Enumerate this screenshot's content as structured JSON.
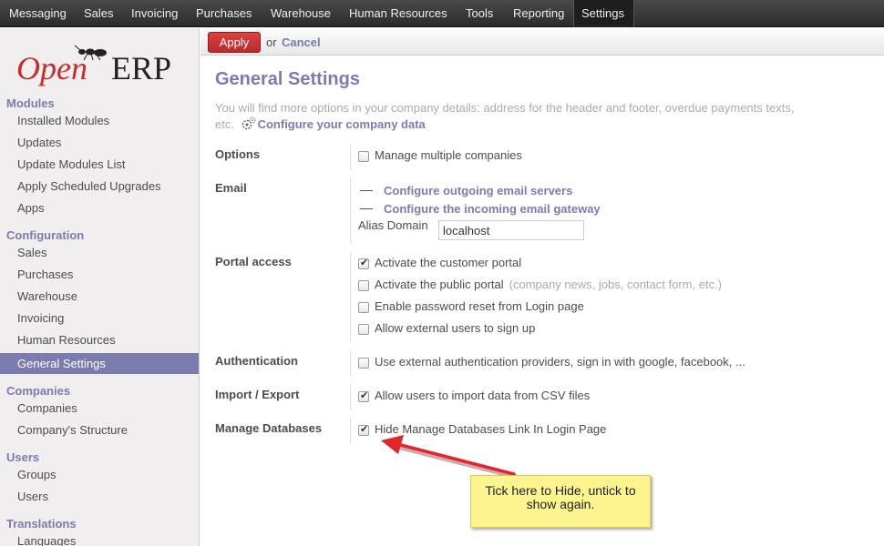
{
  "top_menu": {
    "items": [
      "Messaging",
      "Sales",
      "Invoicing",
      "Purchases",
      "Warehouse",
      "Human Resources",
      "Tools",
      "Reporting",
      "Settings"
    ],
    "active": "Settings"
  },
  "logo": {
    "text_open": "Open",
    "text_erp": "ERP"
  },
  "sidebar": {
    "sections": [
      {
        "header": "Modules",
        "items": [
          "Installed Modules",
          "Updates",
          "Update Modules List",
          "Apply Scheduled Upgrades",
          "Apps"
        ]
      },
      {
        "header": "Configuration",
        "items": [
          "Sales",
          "Purchases",
          "Warehouse",
          "Invoicing",
          "Human Resources",
          "General Settings"
        ]
      },
      {
        "header": "Companies",
        "items": [
          "Companies",
          "Company's Structure"
        ]
      },
      {
        "header": "Users",
        "items": [
          "Groups",
          "Users"
        ]
      },
      {
        "header": "Translations",
        "items": [
          "Languages"
        ]
      }
    ],
    "active_item": "General Settings"
  },
  "actionbar": {
    "apply_label": "Apply",
    "or_label": "or",
    "cancel_label": "Cancel"
  },
  "main": {
    "title": "General Settings",
    "intro": "You will find more options in your company details: address for the header and footer, overdue payments texts, etc.",
    "intro_link": "Configure your company data",
    "sections": {
      "options": {
        "label": "Options",
        "items": [
          {
            "text": "Manage multiple companies",
            "checked": false
          }
        ]
      },
      "email": {
        "label": "Email",
        "links": [
          "Configure outgoing email servers",
          "Configure the incoming email gateway"
        ],
        "alias_label": "Alias Domain",
        "alias_value": "localhost"
      },
      "portal": {
        "label": "Portal access",
        "items": [
          {
            "text": "Activate the customer portal",
            "checked": true,
            "note": ""
          },
          {
            "text": "Activate the public portal",
            "checked": false,
            "note": "(company news, jobs, contact form, etc.)"
          },
          {
            "text": "Enable password reset from Login page",
            "checked": false,
            "note": ""
          },
          {
            "text": "Allow external users to sign up",
            "checked": false,
            "note": ""
          }
        ]
      },
      "authentication": {
        "label": "Authentication",
        "items": [
          {
            "text": "Use external authentication providers, sign in with google, facebook, ...",
            "checked": false
          }
        ]
      },
      "import_export": {
        "label": "Import / Export",
        "items": [
          {
            "text": "Allow users to import data from CSV files",
            "checked": true
          }
        ]
      },
      "manage_databases": {
        "label": "Manage Databases",
        "items": [
          {
            "text": "Hide Manage Databases Link In Login Page",
            "checked": true
          }
        ]
      }
    }
  },
  "annotation": {
    "line1": "Tick here to Hide, untick to",
    "line2": "show again.",
    "arrow_color": "#e0252b"
  },
  "colors": {
    "accent": "#7c7bad",
    "topbar": "#2b2b2b",
    "apply": "#c93434",
    "callout": "#fbf48f"
  }
}
